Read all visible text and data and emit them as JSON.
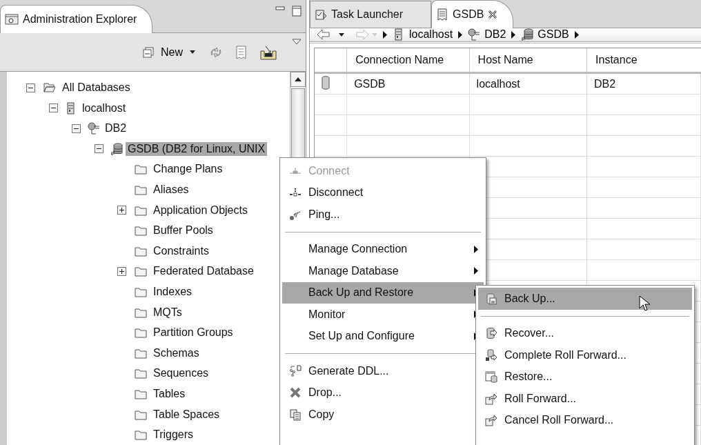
{
  "explorer": {
    "title": "Administration Explorer",
    "toolbar": {
      "new_label": "New"
    },
    "tree": [
      {
        "label": "All Databases",
        "kind": "folder-open",
        "expanded": true,
        "selected": false,
        "children": [
          {
            "label": "localhost",
            "kind": "server",
            "expanded": true,
            "selected": false,
            "children": [
              {
                "label": "DB2",
                "kind": "instance",
                "expanded": true,
                "selected": false,
                "children": [
                  {
                    "label": "GSDB (DB2 for Linux, UNIX",
                    "kind": "database",
                    "expanded": true,
                    "selected": true,
                    "children": [
                      {
                        "label": "Change Plans",
                        "kind": "folder",
                        "selected": false
                      },
                      {
                        "label": "Aliases",
                        "kind": "folder",
                        "selected": false
                      },
                      {
                        "label": "Application Objects",
                        "kind": "folder",
                        "expanded": false,
                        "selected": false
                      },
                      {
                        "label": "Buffer Pools",
                        "kind": "folder",
                        "selected": false
                      },
                      {
                        "label": "Constraints",
                        "kind": "folder",
                        "selected": false
                      },
                      {
                        "label": "Federated Database",
                        "kind": "folder",
                        "expanded": false,
                        "selected": false
                      },
                      {
                        "label": "Indexes",
                        "kind": "folder",
                        "selected": false
                      },
                      {
                        "label": "MQTs",
                        "kind": "folder",
                        "selected": false
                      },
                      {
                        "label": "Partition Groups",
                        "kind": "folder",
                        "selected": false
                      },
                      {
                        "label": "Schemas",
                        "kind": "folder",
                        "selected": false
                      },
                      {
                        "label": "Sequences",
                        "kind": "folder",
                        "selected": false
                      },
                      {
                        "label": "Tables",
                        "kind": "folder",
                        "selected": false
                      },
                      {
                        "label": "Table Spaces",
                        "kind": "folder",
                        "selected": false
                      },
                      {
                        "label": "Triggers",
                        "kind": "folder",
                        "selected": false
                      }
                    ]
                  }
                ]
              }
            ]
          }
        ]
      }
    ]
  },
  "editor": {
    "tabs": [
      {
        "label": "Task Launcher",
        "kind": "tasks",
        "selected": false
      },
      {
        "label": "GSDB",
        "kind": "list",
        "selected": true
      }
    ],
    "breadcrumb": {
      "back_disabled": false,
      "forward_disabled": true,
      "crumbs": [
        {
          "label": "localhost",
          "kind": "server"
        },
        {
          "label": "DB2",
          "kind": "instance"
        },
        {
          "label": "GSDB",
          "kind": "database"
        }
      ]
    },
    "table": {
      "columns": [
        "Connection Name",
        "Host Name",
        "Instance"
      ],
      "rows": [
        [
          "GSDB",
          "localhost",
          "DB2"
        ]
      ]
    }
  },
  "context_menu": {
    "groups": [
      [
        {
          "label": "Connect",
          "kind": "connect",
          "disabled": true,
          "submenu": false,
          "selected": false
        },
        {
          "label": "Disconnect",
          "kind": "disconnect",
          "disabled": false,
          "submenu": false,
          "selected": false
        },
        {
          "label": "Ping...",
          "kind": "ping",
          "disabled": false,
          "submenu": false,
          "selected": false
        }
      ],
      [
        {
          "label": "Manage Connection",
          "kind": "plain",
          "disabled": false,
          "submenu": true,
          "selected": false
        },
        {
          "label": "Manage Database",
          "kind": "plain",
          "disabled": false,
          "submenu": true,
          "selected": false
        },
        {
          "label": "Back Up and Restore",
          "kind": "plain",
          "disabled": false,
          "submenu": true,
          "selected": true
        },
        {
          "label": "Monitor",
          "kind": "plain",
          "disabled": false,
          "submenu": true,
          "selected": false
        },
        {
          "label": "Set Up and Configure",
          "kind": "plain",
          "disabled": false,
          "submenu": true,
          "selected": false
        }
      ],
      [
        {
          "label": "Generate DDL...",
          "kind": "ddl",
          "disabled": false,
          "submenu": false,
          "selected": false
        },
        {
          "label": "Drop...",
          "kind": "drop",
          "disabled": false,
          "submenu": false,
          "selected": false
        },
        {
          "label": "Copy",
          "kind": "copy",
          "disabled": false,
          "submenu": false,
          "selected": false
        }
      ]
    ]
  },
  "submenu": {
    "groups": [
      [
        {
          "label": "Back Up...",
          "kind": "backup",
          "selected": true
        }
      ],
      [
        {
          "label": "Recover...",
          "kind": "recover",
          "selected": false
        },
        {
          "label": "Complete Roll Forward...",
          "kind": "complete",
          "selected": false
        },
        {
          "label": "Restore...",
          "kind": "restore",
          "selected": false
        },
        {
          "label": "Roll Forward...",
          "kind": "rollfwd",
          "selected": false
        },
        {
          "label": "Cancel Roll Forward...",
          "kind": "rollfwd",
          "selected": false
        }
      ]
    ]
  }
}
